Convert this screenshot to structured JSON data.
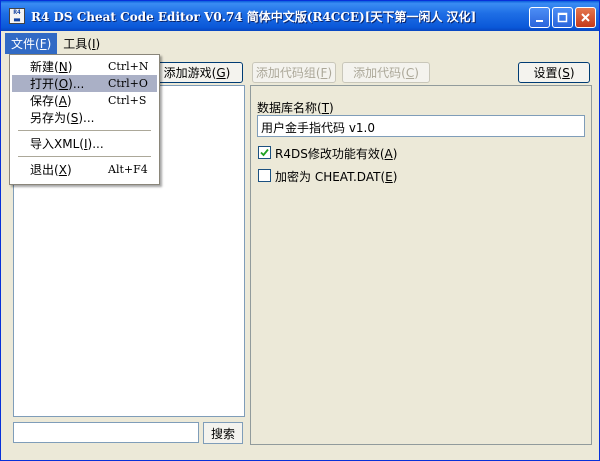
{
  "window": {
    "title": "R4 DS Cheat Code Editor V0.74 简体中文版(R4CCE)[天下第一闲人 汉化]",
    "app_icon_text": "R4"
  },
  "menubar": {
    "file": {
      "label": "文件",
      "mnemonic": "F"
    },
    "tools": {
      "label": "工具",
      "mnemonic": "I"
    }
  },
  "file_menu": {
    "items": [
      {
        "label": "新建",
        "mnemonic": "N",
        "suffix": "",
        "shortcut": "Ctrl+N"
      },
      {
        "label": "打开",
        "mnemonic": "O",
        "suffix": "...",
        "shortcut": "Ctrl+O"
      },
      {
        "label": "保存",
        "mnemonic": "A",
        "suffix": "",
        "shortcut": "Ctrl+S"
      },
      {
        "label": "另存为",
        "mnemonic": "S",
        "suffix": "...",
        "shortcut": ""
      },
      {
        "label": "导入XML",
        "mnemonic": "I",
        "suffix": "...",
        "shortcut": ""
      },
      {
        "label": "退出",
        "mnemonic": "X",
        "suffix": "",
        "shortcut": "Alt+F4"
      }
    ]
  },
  "toolbar": {
    "add_game": {
      "label": "添加游戏",
      "mnemonic": "G"
    },
    "add_code_group": {
      "label": "添加代码组",
      "mnemonic": "F"
    },
    "add_code": {
      "label": "添加代码",
      "mnemonic": "C"
    },
    "settings": {
      "label": "设置",
      "mnemonic": "S"
    }
  },
  "search": {
    "value": "",
    "button_label": "搜索"
  },
  "details": {
    "db_name_label": "数据库名称",
    "db_name_mnemonic": "T",
    "db_name_value": "用户金手指代码 v1.0",
    "r4ds_label": "R4DS修改功能有效",
    "r4ds_mnemonic": "A",
    "r4ds_checked": true,
    "encrypt_label": "加密为 CHEAT.DAT",
    "encrypt_mnemonic": "E",
    "encrypt_checked": false
  }
}
